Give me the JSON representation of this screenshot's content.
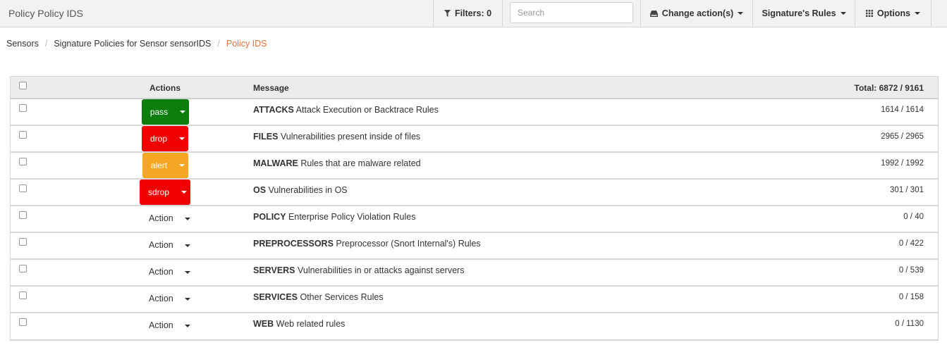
{
  "header": {
    "title": "Policy Policy IDS",
    "filters_label": "Filters: 0",
    "search_placeholder": "Search",
    "change_actions_label": "Change action(s)",
    "signature_rules_label": "Signature's Rules",
    "options_label": "Options"
  },
  "breadcrumb": {
    "items": [
      "Sensors",
      "Signature Policies for Sensor sensorIDS"
    ],
    "active": "Policy IDS",
    "divider": "/"
  },
  "table": {
    "headers": {
      "actions": "Actions",
      "message": "Message",
      "total": "Total: 6872 / 9161"
    },
    "rows": [
      {
        "action": "pass",
        "action_color": "#0a7d0a",
        "category": "ATTACKS",
        "description": "Attack Execution or Backtrace Rules",
        "count": "1614 / 1614"
      },
      {
        "action": "drop",
        "action_color": "#f00000",
        "category": "FILES",
        "description": "Vulnerabilities present inside of files",
        "count": "2965 / 2965"
      },
      {
        "action": "alert",
        "action_color": "#f5a623",
        "category": "MALWARE",
        "description": "Rules that are malware related",
        "count": "1992 / 1992"
      },
      {
        "action": "sdrop",
        "action_color": "#f00000",
        "category": "OS",
        "description": "Vulnerabilities in OS",
        "count": "301 / 301"
      },
      {
        "action": "Action",
        "action_color": "",
        "category": "POLICY",
        "description": "Enterprise Policy Violation Rules",
        "count": "0 / 40"
      },
      {
        "action": "Action",
        "action_color": "",
        "category": "PREPROCESSORS",
        "description": "Preprocessor (Snort Internal's) Rules",
        "count": "0 / 422"
      },
      {
        "action": "Action",
        "action_color": "",
        "category": "SERVERS",
        "description": "Vulnerabilities in or attacks against servers",
        "count": "0 / 539"
      },
      {
        "action": "Action",
        "action_color": "",
        "category": "SERVICES",
        "description": "Other Services Rules",
        "count": "0 / 158"
      },
      {
        "action": "Action",
        "action_color": "",
        "category": "WEB",
        "description": "Web related rules",
        "count": "0 / 1130"
      }
    ]
  },
  "icons": {
    "filter": "filter-icon",
    "change_action": "drive-icon",
    "options": "grid-icon"
  }
}
